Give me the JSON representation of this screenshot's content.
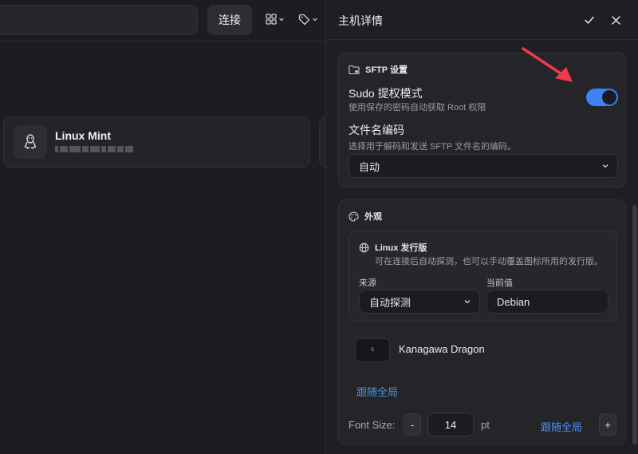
{
  "toolbar": {
    "connect_label": "连接",
    "grid_icon": "grid-icon",
    "tag_icon": "tag-icon"
  },
  "host": {
    "name": "Linux Mint",
    "icon": "linux-tux-icon"
  },
  "panel": {
    "title": "主机详情",
    "sftp": {
      "title": "SFTP 设置",
      "sudo_label": "Sudo 提权模式",
      "sudo_desc": "使用保存的密码自动获取 Root 权限",
      "sudo_enabled": true,
      "encoding_label": "文件名编码",
      "encoding_desc": "选择用于解码和发送 SFTP 文件名的编码。",
      "encoding_value": "自动"
    },
    "appearance": {
      "title": "外观",
      "distro_title": "Linux 发行版",
      "distro_desc": "可在连接后自动探测，也可以手动覆盖图标所用的发行版。",
      "source_label": "来源",
      "source_value": "自动探测",
      "current_label": "当前值",
      "current_value": "Debian",
      "theme_thumb_text": "$",
      "theme_name": "Kanagawa Dragon",
      "follow_global_1": "跟随全局",
      "font_size_label": "Font Size:",
      "minus_label": "-",
      "font_size_value": "14",
      "unit": "pt",
      "follow_global_2": "跟随全局",
      "plus_label": "+"
    }
  },
  "colors": {
    "accent": "#3b82f6",
    "link": "#4d8fe8",
    "annotation_arrow": "#f03a4b"
  }
}
